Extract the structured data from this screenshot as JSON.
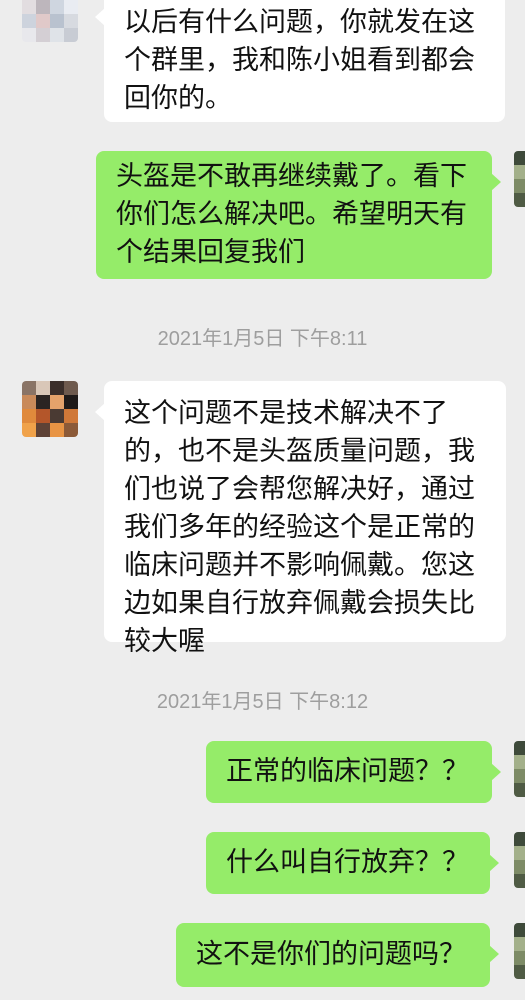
{
  "messages": [
    {
      "side": "left",
      "text": "以后有什么问题，你就发在这\n个群里，我和陈小姐看到都会\n回你的。"
    },
    {
      "side": "right",
      "text": "头盔是不敢再继续戴了。看下\n你们怎么解决吧。希望明天有\n个结果回复我们"
    },
    {
      "side": "left",
      "text": "这个问题不是技术解决不了\n的，也不是头盔质量问题，我\n们也说了会帮您解决好，通过\n我们多年的经验这个是正常的\n临床问题并不影响佩戴。您这\n边如果自行放弃佩戴会损失比\n较大喔"
    },
    {
      "side": "right",
      "text": "正常的临床问题？？"
    },
    {
      "side": "right",
      "text": "什么叫自行放弃？？"
    },
    {
      "side": "right",
      "text": "这不是你们的问题吗？"
    }
  ],
  "timestamps": [
    "2021年1月5日 下午8:11",
    "2021年1月5日 下午8:12"
  ],
  "colors": {
    "background": "#ededed",
    "received_bubble": "#ffffff",
    "sent_bubble": "#95ec69",
    "timestamp_text": "#9e9e9e"
  }
}
